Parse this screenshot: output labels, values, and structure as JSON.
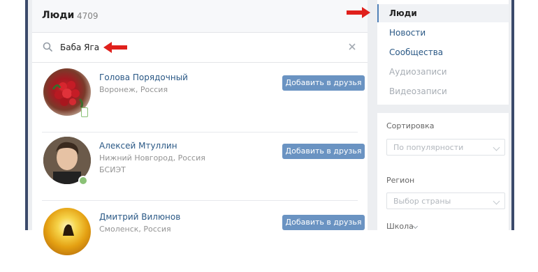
{
  "main": {
    "title": "Люди",
    "count": "4709",
    "search": {
      "value": "Баба Яга"
    }
  },
  "people": [
    {
      "name": "Голова Порядочный",
      "location": "Воронеж, Россия",
      "extra": "",
      "status": "mobile",
      "button": "Добавить в друзья"
    },
    {
      "name": "Алексей Мтуллин",
      "location": "Нижний Новгород, Россия",
      "extra": "БСИЭТ",
      "status": "online",
      "button": "Добавить в друзья"
    },
    {
      "name": "Дмитрий Вилюнов",
      "location": "Смоленск, Россия",
      "extra": "",
      "status": "",
      "button": "Добавить в друзья"
    }
  ],
  "sidebar": {
    "items": [
      {
        "label": "Люди",
        "state": "active"
      },
      {
        "label": "Новости",
        "state": "normal"
      },
      {
        "label": "Сообщества",
        "state": "normal"
      },
      {
        "label": "Аудиозаписи",
        "state": "dim"
      },
      {
        "label": "Видеозаписи",
        "state": "dim"
      }
    ],
    "filters": {
      "sort_label": "Сортировка",
      "sort_value": "По популярности",
      "region_label": "Регион",
      "region_value": "Выбор страны",
      "school_label": "Школа"
    }
  },
  "colors": {
    "accent": "#5181b8",
    "link": "#2a5885",
    "arrow": "#e0201c",
    "online": "#8ac176"
  }
}
